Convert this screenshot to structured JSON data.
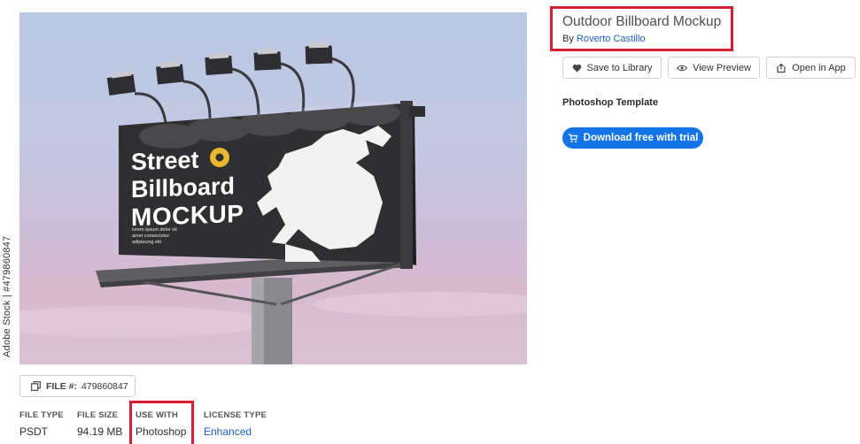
{
  "asset": {
    "title": "Outdoor Billboard Mockup",
    "by_prefix": "By",
    "author": "Roverto Castillo",
    "template_type": "Photoshop Template"
  },
  "actions": {
    "save_label": "Save to Library",
    "preview_label": "View Preview",
    "open_label": "Open in App",
    "download_label": "Download free with trial"
  },
  "preview": {
    "watermark": "Adobe Stock | #479860847",
    "billboard_line1": "Street",
    "billboard_line2": "Billboard",
    "billboard_line3": "MOCKUP",
    "billboard_small": "lorem ipsum dolor sit amet consectetur adipiscing elit"
  },
  "file": {
    "label": "FILE #:",
    "number": "479860847"
  },
  "meta": {
    "file_type_label": "FILE TYPE",
    "file_type": "PSDT",
    "file_size_label": "FILE SIZE",
    "file_size": "94.19 MB",
    "use_with_label": "USE WITH",
    "use_with": "Photoshop",
    "license_label": "LICENSE TYPE",
    "license": "Enhanced"
  },
  "colors": {
    "accent_blue": "#1473e6",
    "link_blue": "#1d5fc4",
    "highlight_red": "#d42030"
  }
}
